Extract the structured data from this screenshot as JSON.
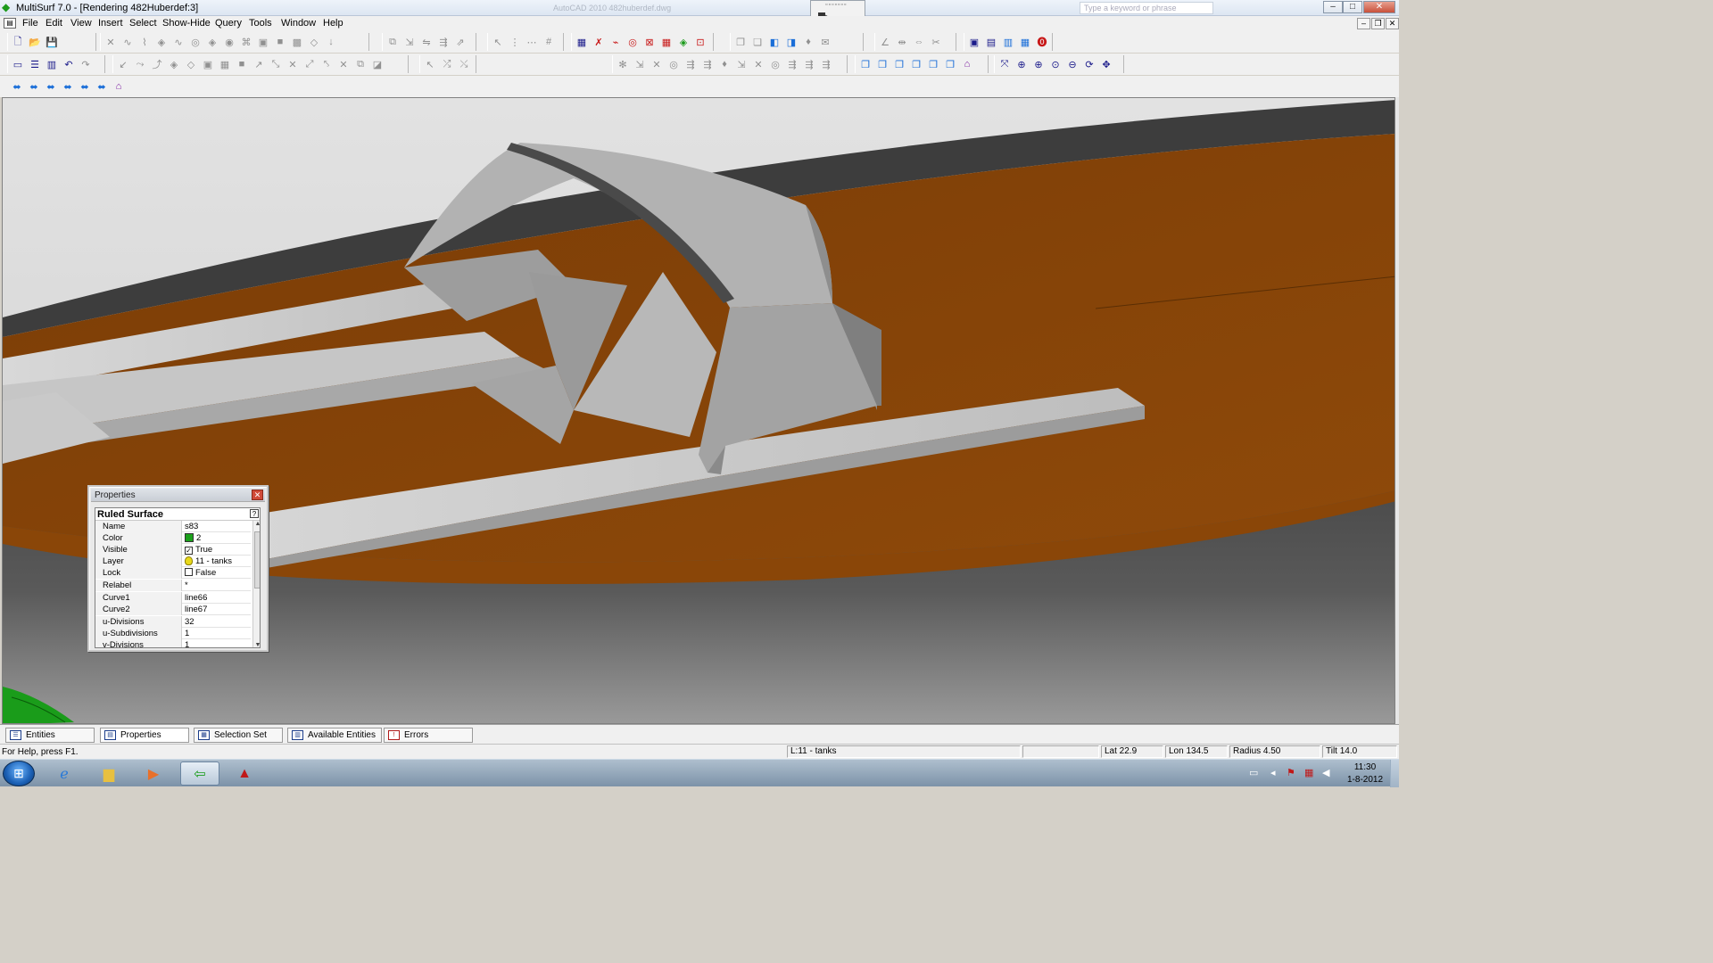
{
  "window": {
    "title": "MultiSurf 7.0 - [Rendering 482Huberdef:3]",
    "ghost_title": "AutoCAD 2010  482huberdef.dwg",
    "search_placeholder": "Type a keyword or phrase",
    "minimize": "–",
    "maximize": "□",
    "close": "✕",
    "mdi_minimize": "–",
    "mdi_restore": "❐",
    "mdi_close": "✕"
  },
  "menu": [
    "File",
    "Edit",
    "View",
    "Insert",
    "Select",
    "Show-Hide",
    "Query",
    "Tools",
    "Window",
    "Help"
  ],
  "properties": {
    "panel_title": "Properties",
    "close": "✕",
    "entity_type": "Ruled Surface",
    "help": "?",
    "rows": [
      {
        "name": "Name",
        "value": "s83"
      },
      {
        "name": "Color",
        "value": "2"
      },
      {
        "name": "Visible",
        "value": "True"
      },
      {
        "name": "Layer",
        "value": "11 - tanks"
      },
      {
        "name": "Lock",
        "value": "False"
      },
      {
        "name": "Relabel",
        "value": "*"
      },
      {
        "name": "Curve1",
        "value": "line66"
      },
      {
        "name": "Curve2",
        "value": "line67"
      },
      {
        "name": "u-Divisions",
        "value": "32"
      },
      {
        "name": "u-Subdivisions",
        "value": "1"
      },
      {
        "name": "v-Divisions",
        "value": "1"
      }
    ],
    "color_swatch": "#1aa01a"
  },
  "tabs": [
    {
      "label": "Entities",
      "icon": "list-icon"
    },
    {
      "label": "Properties",
      "icon": "properties-icon"
    },
    {
      "label": "Selection Set",
      "icon": "selection-icon"
    },
    {
      "label": "Available Entities",
      "icon": "available-icon"
    },
    {
      "label": "Errors",
      "icon": "errors-icon"
    }
  ],
  "status": {
    "help": "For Help, press F1.",
    "layer": "L:11 - tanks",
    "lat": "Lat 22.9",
    "lon": "Lon 134.5",
    "radius": "Radius 4.50",
    "tilt": "Tilt 14.0"
  },
  "taskbar": {
    "time": "11:30",
    "date": "1-8-2012"
  },
  "colors": {
    "deck_orange": "#8b4a0a",
    "structure_gray": "#a6a6a6",
    "hull_dark": "#3a3a3a"
  }
}
